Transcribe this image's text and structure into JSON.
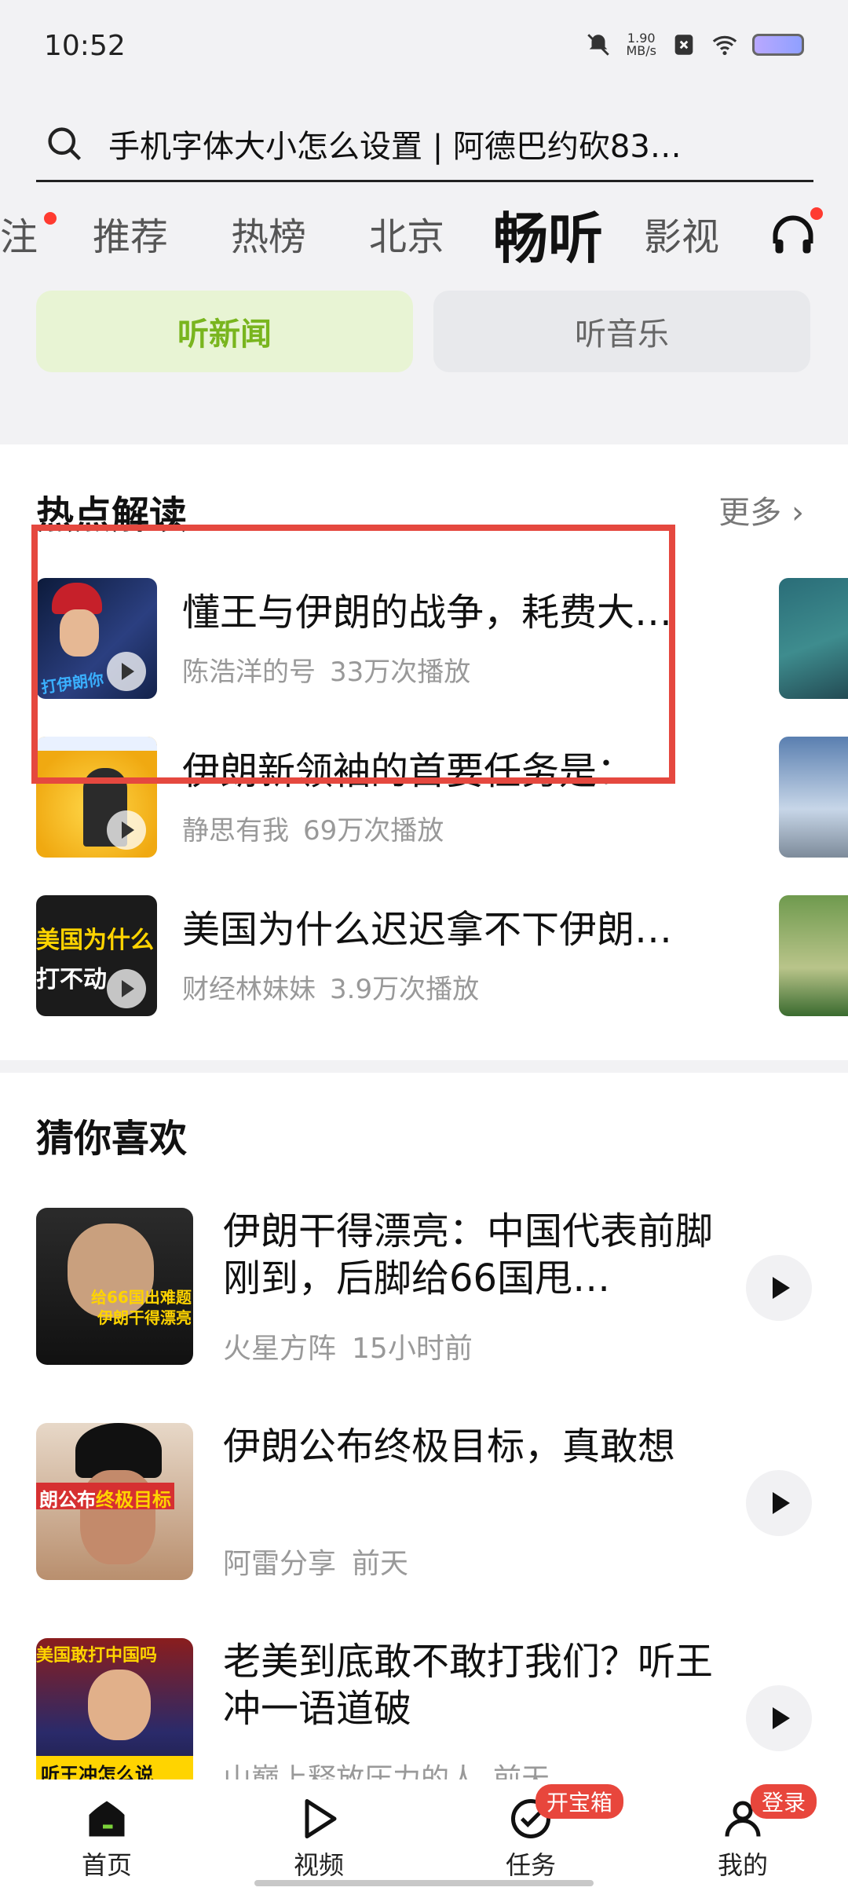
{
  "status_bar": {
    "time": "10:52",
    "net_speed_value": "1.90",
    "net_speed_unit": "MB/s"
  },
  "search": {
    "query": "手机字体大小怎么设置 | 阿德巴约砍83…"
  },
  "tabs": [
    {
      "label": "注"
    },
    {
      "label": "推荐"
    },
    {
      "label": "热榜"
    },
    {
      "label": "北京"
    },
    {
      "label": "畅听",
      "active": true
    },
    {
      "label": "影视"
    }
  ],
  "segments": {
    "news": "听新闻",
    "music": "听音乐"
  },
  "hot": {
    "title": "热点解读",
    "more": "更多 ›",
    "items": [
      {
        "title": "懂王与伊朗的战争，耗费大…",
        "author": "陈浩洋的号",
        "plays": "33万次播放"
      },
      {
        "title": "伊朗新领袖的首要任务是：…",
        "author": "静思有我",
        "plays": "69万次播放"
      },
      {
        "title": "美国为什么迟迟拿不下伊朗…",
        "author": "财经林妹妹",
        "plays": "3.9万次播放"
      }
    ]
  },
  "recommend": {
    "title": "猜你喜欢",
    "items": [
      {
        "title": "伊朗干得漂亮：中国代表前脚刚到，后脚给66国甩…",
        "author": "火星方阵",
        "time": "15小时前"
      },
      {
        "title": "伊朗公布终极目标，真敢想",
        "author": "阿雷分享",
        "time": "前天"
      },
      {
        "title": "老美到底敢不敢打我们？听王冲一语道破",
        "author": "山巅上释放压力的人",
        "time": "前天"
      }
    ]
  },
  "thumb_text": {
    "hot1": "打伊朗你",
    "hot3_a": "美国为什么",
    "hot3_b": "打不动",
    "rec1_a": "给66国出难题",
    "rec1_b": "伊朗干得漂亮",
    "rec2_a": "朗公布",
    "rec2_b": "终极目标",
    "rec3_a": "美国敢打中国吗",
    "rec3_b": "听王冲怎么说"
  },
  "navbar": {
    "home": "首页",
    "video": "视频",
    "task": "任务",
    "task_badge": "开宝箱",
    "mine": "我的",
    "mine_badge": "登录"
  },
  "colors": {
    "accent_green": "#79b51e",
    "highlight_red": "#e5483f",
    "badge_red": "#e8463c"
  }
}
